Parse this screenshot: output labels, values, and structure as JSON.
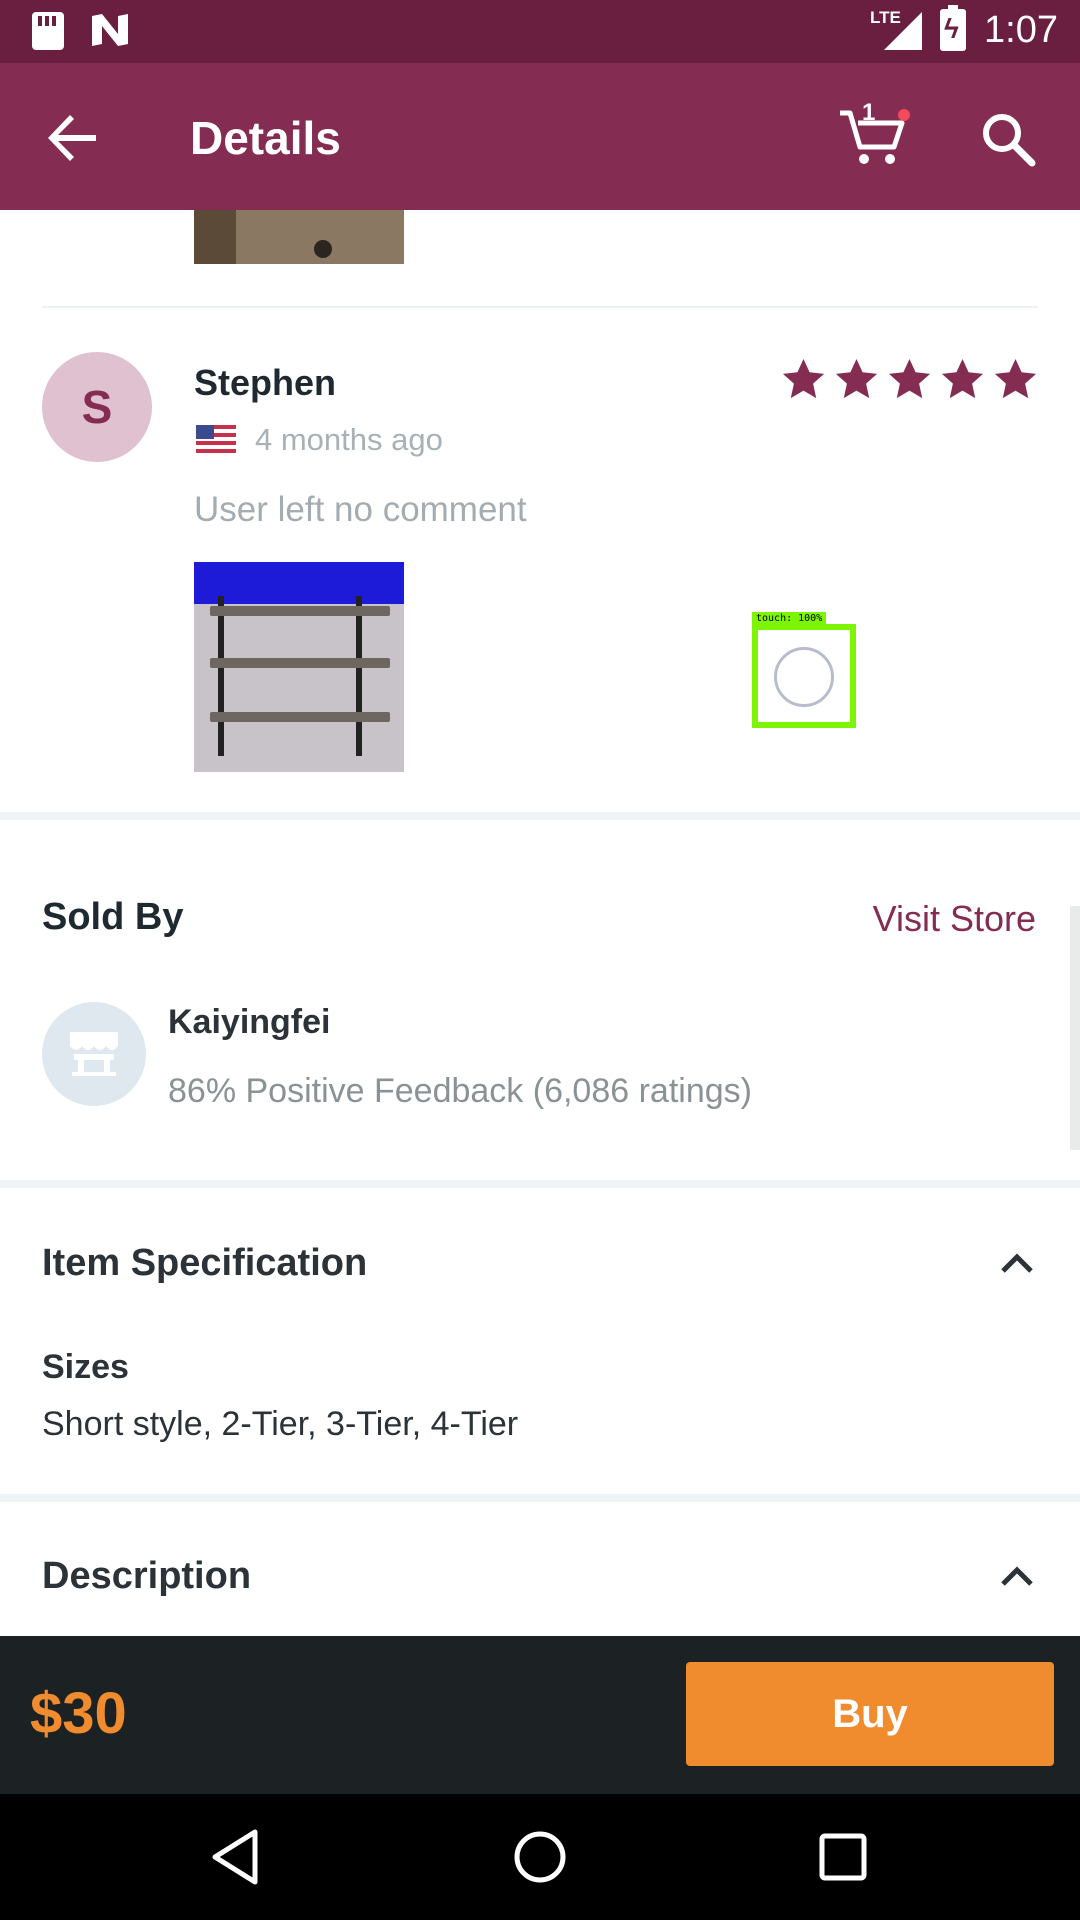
{
  "status_bar": {
    "network": "LTE",
    "time": "1:07"
  },
  "app_bar": {
    "title": "Details",
    "cart_count": "1"
  },
  "review": {
    "avatar_letter": "S",
    "name": "Stephen",
    "time_ago": "4 months ago",
    "comment": "User left no comment",
    "rating": 5,
    "max_rating": 5
  },
  "touch_overlay": {
    "label": "touch: 100%"
  },
  "sold_by": {
    "title": "Sold By",
    "visit_store_label": "Visit Store",
    "store_name": "Kaiyingfei",
    "feedback": "86% Positive Feedback (6,086 ratings)"
  },
  "item_specification": {
    "title": "Item Specification",
    "sizes_label": "Sizes",
    "sizes_value": "Short style, 2-Tier, 3-Tier, 4-Tier"
  },
  "description": {
    "title": "Description"
  },
  "buy_bar": {
    "price": "$30",
    "buy_label": "Buy"
  },
  "colors": {
    "status_bar": "#6a1f41",
    "app_bar": "#842c52",
    "accent": "#842c52",
    "buy": "#f08c2e"
  },
  "icons": {
    "back": "arrow-left-icon",
    "cart": "cart-icon",
    "search": "search-icon",
    "star": "star-icon",
    "expand": "chevron-up-icon"
  }
}
